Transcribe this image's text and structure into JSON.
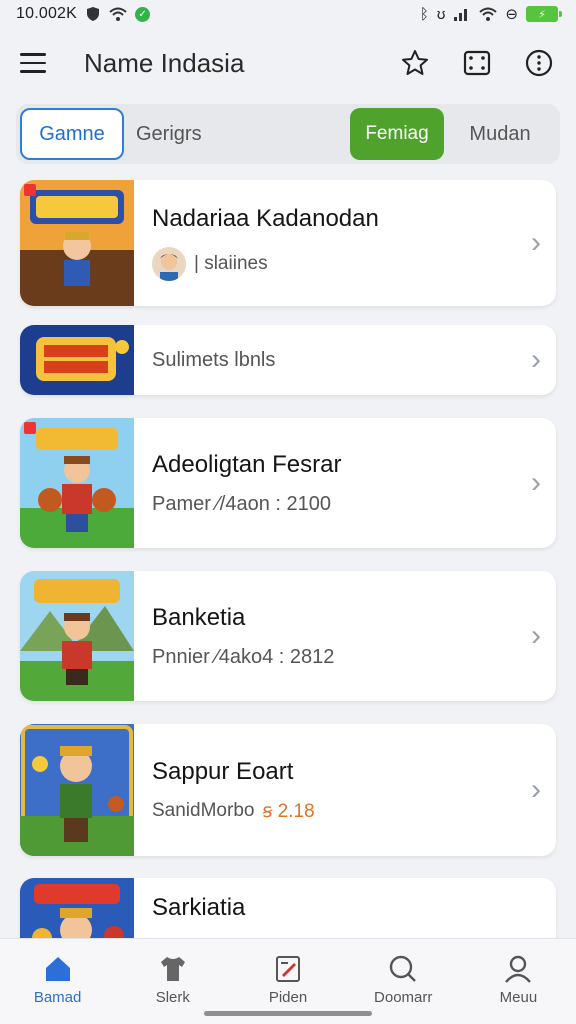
{
  "status": {
    "time": "10.002K"
  },
  "app": {
    "title": "Name Indasia"
  },
  "tabs": [
    {
      "label": "Gamne"
    },
    {
      "label": "Gerigrs"
    },
    {
      "label": "Femiag"
    },
    {
      "label": "Mudan"
    }
  ],
  "items": [
    {
      "title": "Nadariaa Kadanodan",
      "subtitle": "| slaiines"
    },
    {
      "title": "",
      "subtitle": "Sulimets lbnls"
    },
    {
      "title": "Adeoligtan Fesrar",
      "subtitle": "Pamer ⁄/4aon : 2100"
    },
    {
      "title": "Banketia",
      "subtitle": "Pnnier ⁄4ako4 : 2812"
    },
    {
      "title": "Sappur Eoart",
      "subtitle": "SanidMorbo",
      "accent": "ꞩ 2.18"
    },
    {
      "title": "Sarkiatia",
      "subtitle": ""
    }
  ],
  "nav": [
    {
      "label": "Bamad",
      "icon": "home-icon"
    },
    {
      "label": "Slerk",
      "icon": "shirt-icon"
    },
    {
      "label": "Piden",
      "icon": "edit-icon"
    },
    {
      "label": "Doomarr",
      "icon": "search-icon"
    },
    {
      "label": "Meuu",
      "icon": "profile-icon"
    }
  ],
  "colors": {
    "accent_blue": "#2c6fd6",
    "accent_green": "#4fa32c",
    "price_orange": "#e2722a"
  }
}
